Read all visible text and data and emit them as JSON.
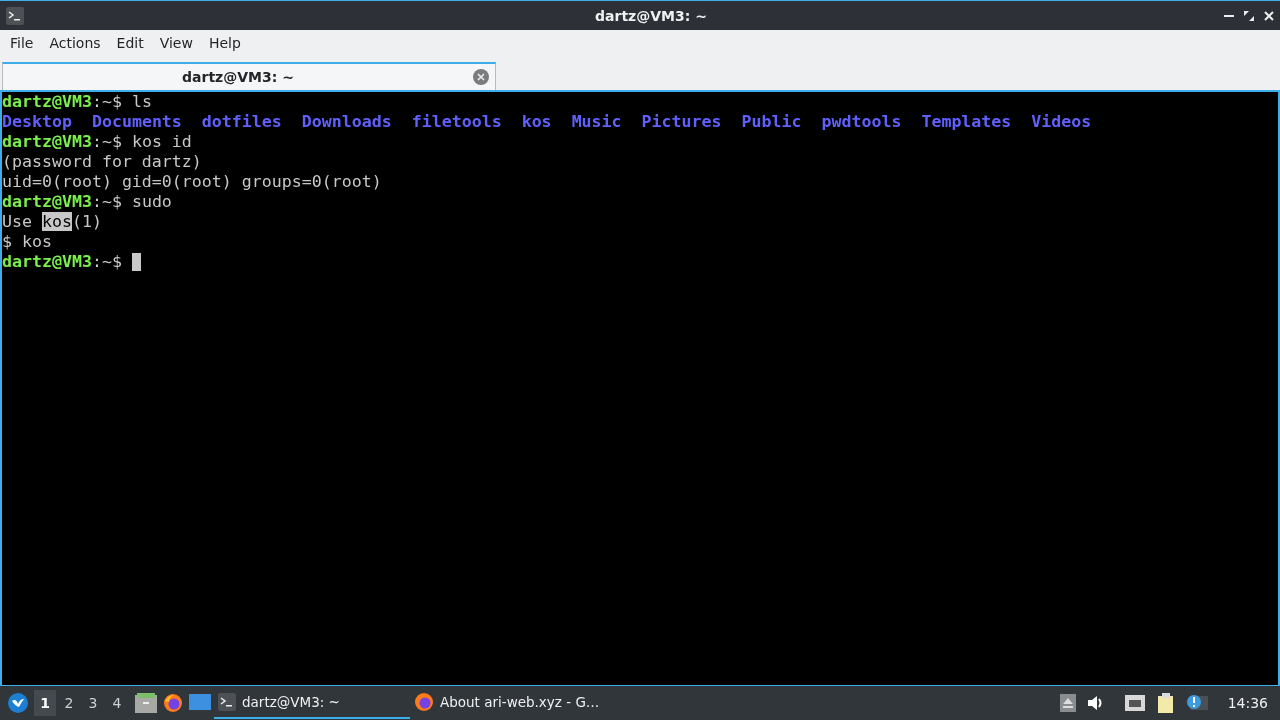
{
  "window": {
    "title": "dartz@VM3: ~"
  },
  "menu": [
    "File",
    "Actions",
    "Edit",
    "View",
    "Help"
  ],
  "tabs": [
    {
      "label": "dartz@VM3: ~",
      "selected": true
    }
  ],
  "terminal": {
    "lines": [
      {
        "kind": "prompt",
        "user": "dartz@VM3",
        "path": ":~$",
        "command": "ls"
      },
      {
        "kind": "listing",
        "items": [
          "Desktop",
          "Documents",
          "dotfiles",
          "Downloads",
          "filetools",
          "kos",
          "Music",
          "Pictures",
          "Public",
          "pwdtools",
          "Templates",
          "Videos"
        ]
      },
      {
        "kind": "prompt",
        "user": "dartz@VM3",
        "path": ":~$",
        "command": "kos id"
      },
      {
        "kind": "output",
        "segments": [
          {
            "text": "(password for dartz)",
            "highlighted": false
          }
        ]
      },
      {
        "kind": "output",
        "segments": [
          {
            "text": "uid=0(root) gid=0(root) groups=0(root)",
            "highlighted": false
          }
        ]
      },
      {
        "kind": "prompt",
        "user": "dartz@VM3",
        "path": ":~$",
        "command": "sudo"
      },
      {
        "kind": "output",
        "segments": [
          {
            "text": "Use ",
            "highlighted": false
          },
          {
            "text": "kos",
            "highlighted": true
          },
          {
            "text": "(1)",
            "highlighted": false
          }
        ]
      },
      {
        "kind": "output",
        "segments": [
          {
            "text": "$ kos",
            "highlighted": false
          }
        ]
      },
      {
        "kind": "prompt",
        "user": "dartz@VM3",
        "path": ":~$",
        "cursor": true
      }
    ]
  },
  "taskbar": {
    "desktops": [
      {
        "label": "1",
        "selected": true
      },
      {
        "label": "2",
        "selected": false
      },
      {
        "label": "3",
        "selected": false
      },
      {
        "label": "4",
        "selected": false
      }
    ],
    "tasks": [
      {
        "kind": "terminal",
        "label": "dartz@VM3: ~",
        "selected": true
      },
      {
        "kind": "browser",
        "label": "About ari-web.xyz - G…",
        "selected": false
      }
    ],
    "clock": "14:36"
  }
}
